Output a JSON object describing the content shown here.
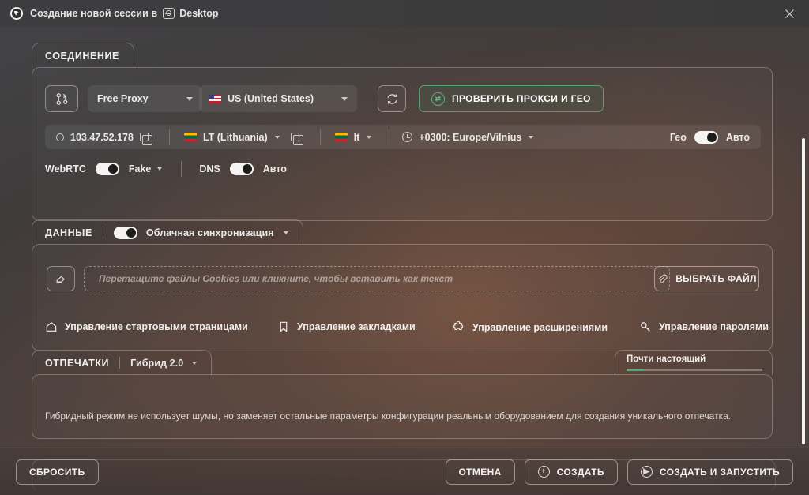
{
  "titlebar": {
    "logo_icon": "app-globe-logo",
    "title": "Создание новой сессии в",
    "profile_icon": "desktop-profile-icon",
    "profile_label": "Desktop",
    "close_icon": "close-icon"
  },
  "connection": {
    "tab_title": "СОЕДИНЕНИЕ",
    "route_icon": "proxy-route-icon",
    "proxy_type": "Free Proxy",
    "country_flag": "flag-us",
    "country": "US (United States)",
    "refresh_icon": "refresh-icon",
    "check_button": {
      "icon": "check-circle-icon",
      "label": "ПРОВЕРИТЬ ПРОКСИ И ГЕО"
    },
    "info": {
      "ip_icon": "ip-dot-icon",
      "ip": "103.47.52.178",
      "copy_icon": "copy-icon",
      "geo_flag": "flag-lt",
      "geo_country": "LT (Lithuania)",
      "geo_copy_icon": "copy-icon",
      "lang_flag": "flag-lt",
      "lang": "lt",
      "clock_icon": "clock-icon",
      "timezone": "+0300: Europe/Vilnius",
      "geo_label": "Гео",
      "geo_toggle": "on",
      "geo_mode": "Авто"
    },
    "webrtc_label": "WebRTC",
    "webrtc_toggle": "on",
    "webrtc_mode": "Fake",
    "dns_label": "DNS",
    "dns_toggle": "on",
    "dns_mode": "Авто"
  },
  "data_section": {
    "tab_title": "ДАННЫЕ",
    "sync_toggle": "on",
    "sync_label": "Облачная синхронизация",
    "clear_icon": "eraser-icon",
    "dropzone_placeholder": "Перетащите файлы Cookies или кликните, чтобы вставить как текст",
    "choose_file": {
      "icon": "paperclip-icon",
      "label": "ВЫБРАТЬ ФАЙЛ"
    },
    "links": [
      {
        "icon": "home-icon",
        "label": "Управление стартовыми страницами"
      },
      {
        "icon": "bookmark-icon",
        "label": "Управление закладками"
      },
      {
        "icon": "puzzle-icon",
        "label": "Управление расширениями"
      },
      {
        "icon": "key-icon",
        "label": "Управление паролями"
      }
    ]
  },
  "fingerprints": {
    "tab_title": "ОТПЕЧАТКИ",
    "mode": "Гибрид 2.0",
    "meter_label": "Почти настоящий",
    "meter_percent": 13,
    "meter_color": "#4caf73",
    "description": "Гибридный режим не использует шумы, но заменяет остальные параметры конфигурации реальным оборудованием для создания уникального отпечатка."
  },
  "footer": {
    "reset": "СБРОСИТЬ",
    "cancel": "ОТМЕНА",
    "create": {
      "icon": "plus-circle-icon",
      "label": "СОЗДАТЬ"
    },
    "create_run": {
      "icon": "play-circle-icon",
      "label": "СОЗДАТЬ И ЗАПУСТИТЬ"
    }
  }
}
